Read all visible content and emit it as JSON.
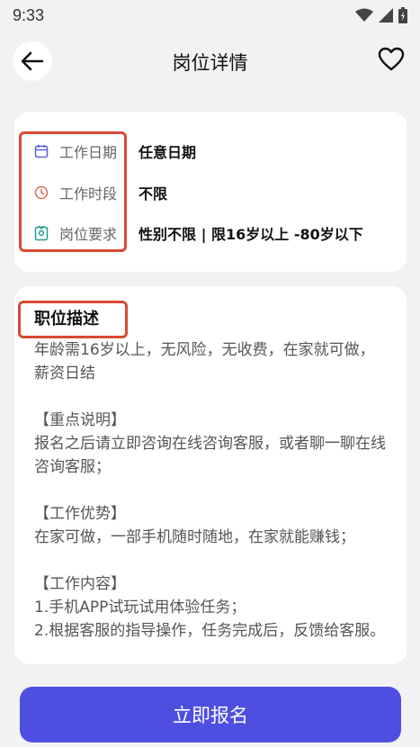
{
  "status_bar": {
    "time": "9:33",
    "icons": [
      "wifi-icon",
      "signal-icon",
      "battery-icon"
    ]
  },
  "header": {
    "title": "岗位详情",
    "back_icon": "arrow-left-icon",
    "favorite_icon": "heart-outline-icon"
  },
  "info": {
    "rows": [
      {
        "icon": "calendar-icon",
        "label": "工作日期",
        "value": "任意日期"
      },
      {
        "icon": "clock-icon",
        "label": "工作时段",
        "value": "不限"
      },
      {
        "icon": "person-requirement-icon",
        "label": "岗位要求",
        "value": "性别不限 | 限16岁以上 -80岁以下"
      }
    ]
  },
  "description": {
    "title": "职位描述",
    "body": "年龄需16岁以上，无风险，无收费，在家就可做，薪资日结\n\n【重点说明】\n报名之后请立即咨询在线咨询客服，或者聊一聊在线咨询客服；\n\n【工作优势】\n在家可做，一部手机随时随地，在家就能赚钱；\n\n【工作内容】\n1.手机APP试玩试用体验任务；\n2.根据客服的指导操作，任务完成后，反馈给客服。"
  },
  "footer": {
    "apply_label": "立即报名"
  },
  "colors": {
    "accent": "#4e4fe0",
    "highlight": "#d84a32",
    "background": "#f2f2f5"
  }
}
